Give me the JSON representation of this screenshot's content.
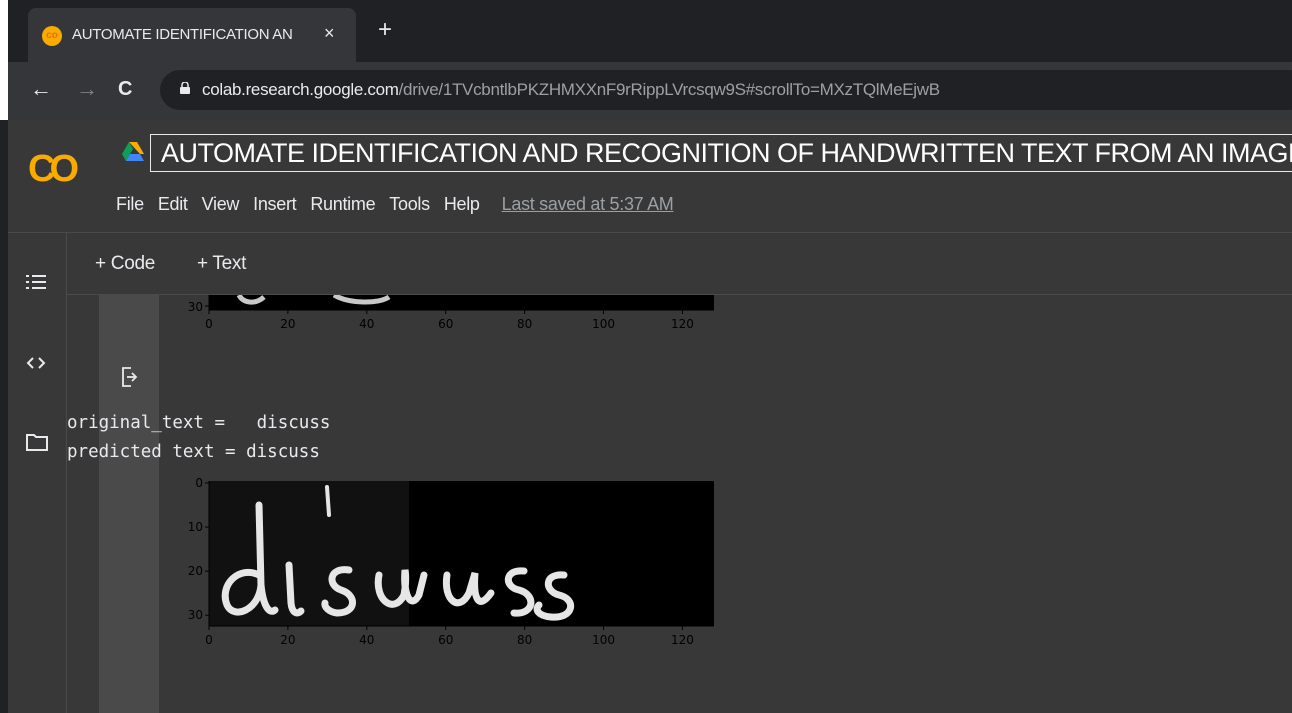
{
  "browser": {
    "tab_title": "AUTOMATE IDENTIFICATION AN",
    "tab_favicon": "co",
    "tab_close": "×",
    "new_tab": "+",
    "back": "←",
    "forward": "→",
    "reload": "C",
    "url_host": "colab.research.google.com",
    "url_path": "/drive/1TVcbntlbPKZHMXXnF9rRippLVrcsqw9S#scrollTo=MXzTQlMeEjwB"
  },
  "colab": {
    "logo": "CO",
    "notebook_title": "AUTOMATE IDENTIFICATION AND RECOGNITION OF HANDWRITTEN TEXT FROM AN  IMAGE",
    "menu": [
      "File",
      "Edit",
      "View",
      "Insert",
      "Runtime",
      "Tools",
      "Help"
    ],
    "last_saved": "Last saved at 5:37 AM",
    "toolbar": {
      "code": "+ Code",
      "text": "+ Text"
    },
    "sidebar_icons": [
      "toc-icon",
      "code-snippets-icon",
      "folder-icon"
    ]
  },
  "output": {
    "original_line": "original_text =   discuss",
    "predicted_line": "predicted text = discuss",
    "plot1": {
      "xticks": [
        "0",
        "20",
        "40",
        "60",
        "80",
        "100",
        "120"
      ],
      "yticks": [
        "30"
      ]
    },
    "plot2": {
      "xticks": [
        "0",
        "20",
        "40",
        "60",
        "80",
        "100",
        "120"
      ],
      "yticks": [
        "0",
        "10",
        "20",
        "30"
      ],
      "image_word": "discuss"
    }
  },
  "colors": {
    "accent": "#f9ab00",
    "bg_dark": "#383838",
    "gutter": "#4a4a4a"
  }
}
